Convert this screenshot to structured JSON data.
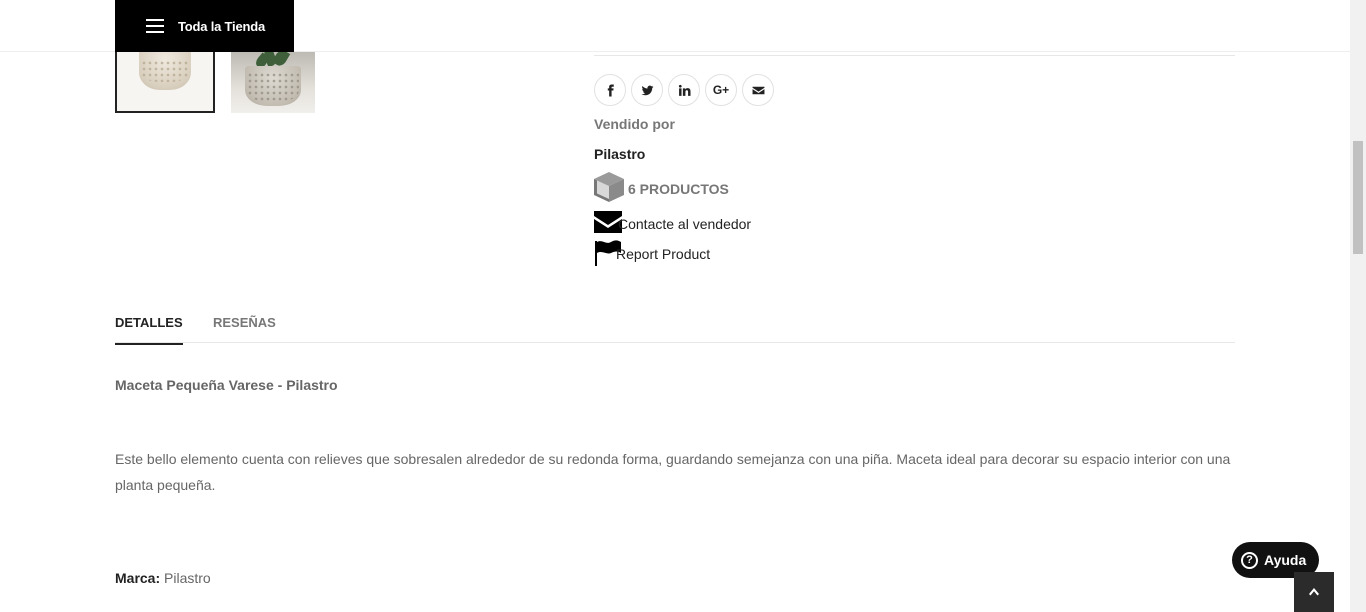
{
  "header": {
    "store_menu_label": "Toda la Tienda"
  },
  "gallery": {
    "thumbnails": [
      "pot-thumbnail-1",
      "pot-thumbnail-2"
    ]
  },
  "share": {
    "buttons": [
      {
        "icon": "facebook-icon",
        "glyph": "f"
      },
      {
        "icon": "twitter-icon",
        "glyph": "t"
      },
      {
        "icon": "linkedin-icon",
        "glyph": "in"
      },
      {
        "icon": "google-plus-icon",
        "glyph": "G+"
      },
      {
        "icon": "email-icon",
        "glyph": "✉"
      }
    ]
  },
  "vendor": {
    "sold_by_label": "Vendido por",
    "name": "Pilastro",
    "products_label": "6 PRODUCTOS",
    "contact_label": "Contacte al vendedor",
    "report_label": "Report Product"
  },
  "tabs": {
    "details": "DETALLES",
    "reviews": "RESEÑAS"
  },
  "description": {
    "title": "Maceta Pequeña Varese - Pilastro",
    "body": "Este bello elemento cuenta con relieves que sobresalen alrededor de su redonda forma, guardando semejanza con una piña. Maceta ideal para decorar su espacio interior con una planta pequeña.",
    "brand_label": "Marca:",
    "brand_value": "Pilastro"
  },
  "help": {
    "label": "Ayuda"
  },
  "colors": {
    "header_bg": "#000000",
    "text_dark": "#222222",
    "text_muted": "#777777",
    "help_bg": "#111111"
  }
}
